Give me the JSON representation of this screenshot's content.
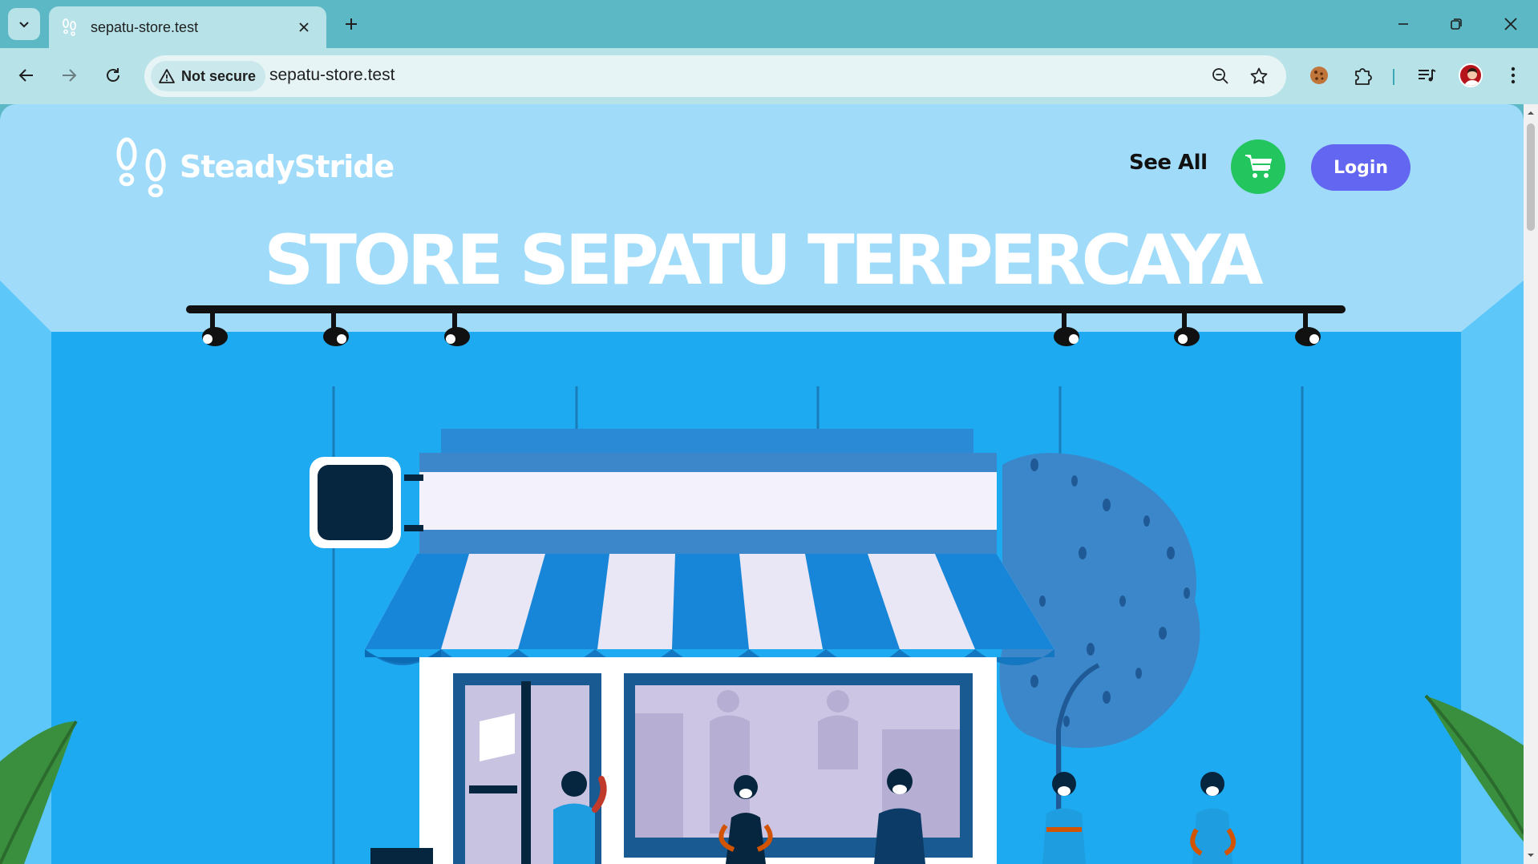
{
  "browser": {
    "tab": {
      "title": "sepatu-store.test"
    },
    "address_bar": {
      "security_label": "Not secure",
      "url": "sepatu-store.test"
    },
    "icons": {
      "tab_search": "chevron-down-icon",
      "new_tab": "plus-icon",
      "back": "arrow-left-icon",
      "forward": "arrow-right-icon",
      "reload": "reload-icon",
      "zoom": "zoom-out-icon",
      "bookmark": "star-icon",
      "cookie_extension": "cookie-icon",
      "extensions": "puzzle-icon",
      "media": "media-control-icon",
      "profile": "avatar",
      "menu": "kebab-menu-icon"
    },
    "theme_color": "#5bb8c4"
  },
  "site": {
    "brand": {
      "name": "SteadyStride"
    },
    "nav": {
      "see_all_label": "See All",
      "login_label": "Login"
    },
    "hero": {
      "headline": "STORE SEPATU TERPERCAYA"
    },
    "colors": {
      "sky": "#2eb3f2",
      "header_band": "#a0dcfa",
      "cart_button": "#22c55e",
      "login_button": "#6366f1"
    }
  }
}
